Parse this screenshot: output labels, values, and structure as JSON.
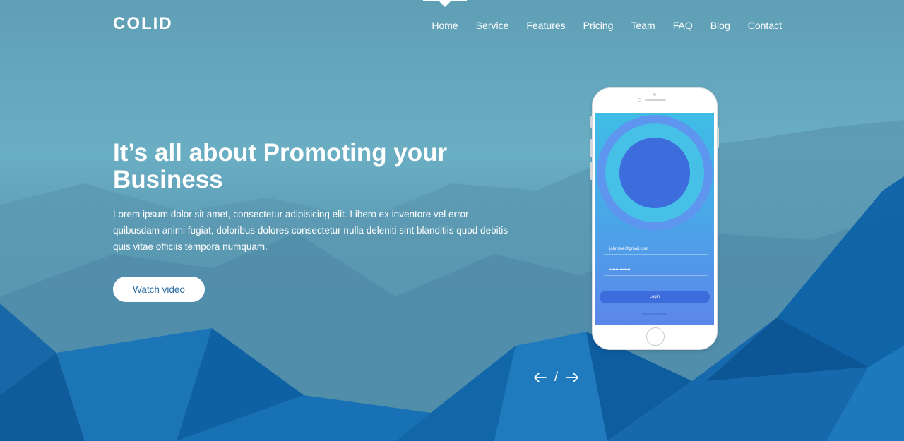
{
  "brand": {
    "logo": "COLID"
  },
  "nav": {
    "items": [
      {
        "label": "Home",
        "active": true
      },
      {
        "label": "Service"
      },
      {
        "label": "Features"
      },
      {
        "label": "Pricing"
      },
      {
        "label": "Team"
      },
      {
        "label": "FAQ"
      },
      {
        "label": "Blog"
      },
      {
        "label": "Contact"
      }
    ]
  },
  "hero": {
    "title": "It’s all about Promoting your Business",
    "description": "Lorem ipsum dolor sit amet, consectetur adipisicing elit. Libero ex inventore vel error quibusdam animi fugiat, doloribus dolores consectetur nulla deleniti sint blanditiis quod debitis quis vitae officiis tempora numquam.",
    "cta": "Watch video"
  },
  "phone": {
    "email_value": "johndoe@gmail.com",
    "password_value": "••••••••••••••",
    "login_label": "Login",
    "forgot_label": "Forgot password?"
  },
  "slider": {
    "prev_icon": "arrow-left-icon",
    "separator": "/",
    "next_icon": "arrow-right-icon"
  },
  "colors": {
    "sky": "#6aaec4",
    "polygon_dark": "#0b5fa3",
    "accent": "#2c6fa6"
  }
}
